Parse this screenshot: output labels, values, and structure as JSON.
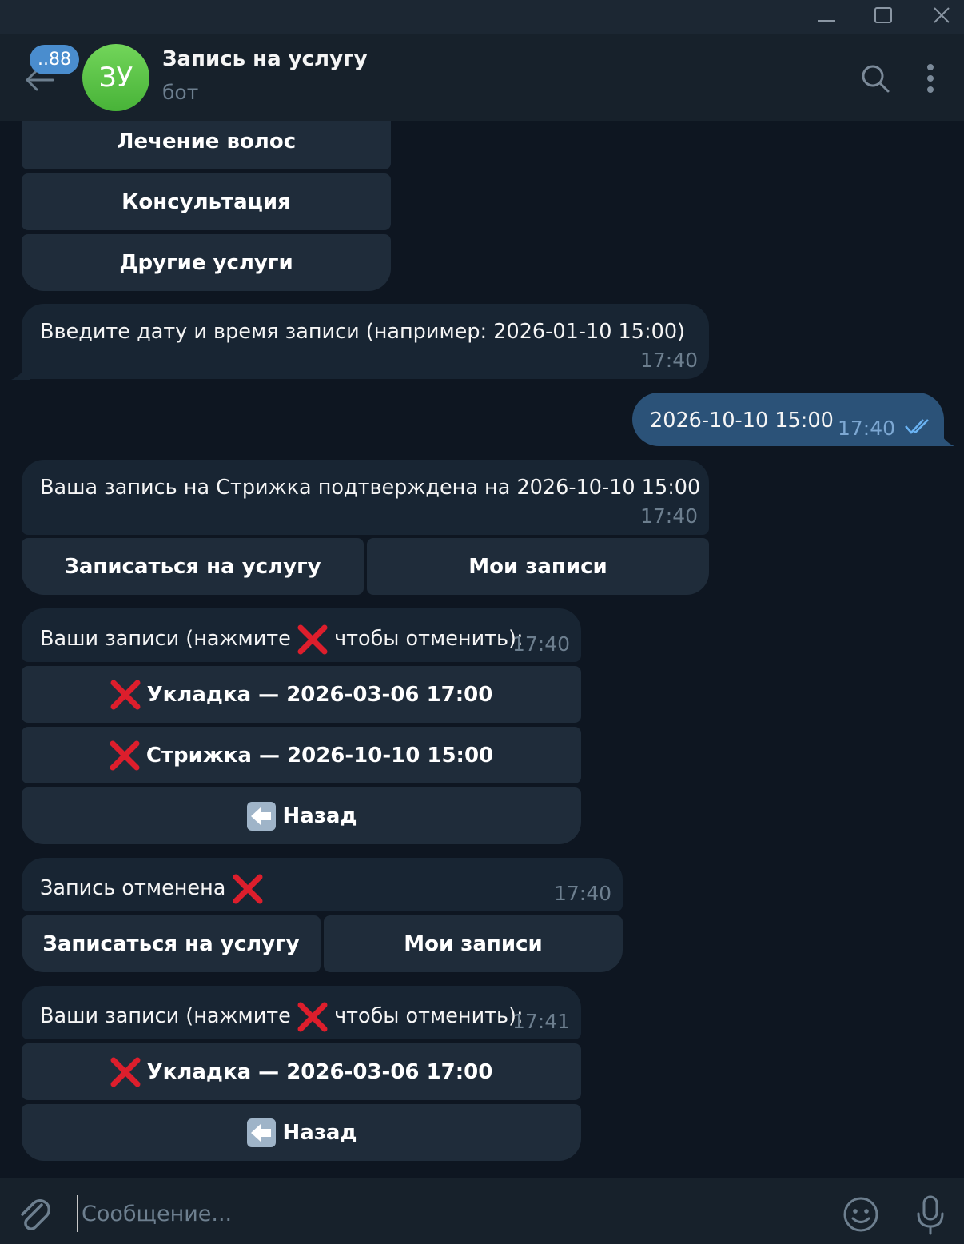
{
  "colors": {
    "bg": "#0e1621",
    "header": "#17212b",
    "bubble_in": "#182533",
    "bubble_out": "#2b5278",
    "button": "#1f2c3a",
    "accent": "#4a8dce",
    "cross": "#dd1e2c"
  },
  "window": {
    "minimize_icon": "minimize-icon",
    "maximize_icon": "maximize-icon",
    "close_icon": "close-icon"
  },
  "header": {
    "unread_badge": "..88",
    "avatar_initials": "ЗУ",
    "title": "Запись на услугу",
    "subtitle": "бот",
    "icons": [
      "back-arrow-icon",
      "search-icon",
      "more-vertical-icon"
    ]
  },
  "services_keyboard": [
    "Лечение волос",
    "Консультация",
    "Другие услуги"
  ],
  "messages": [
    {
      "text": "Введите дату и время записи (например: 2026-01-10 15:00)",
      "time": "17:40"
    },
    {
      "text": "2026-10-10 15:00",
      "time": "17:40",
      "status_icon": "double-check-icon"
    },
    {
      "text": "Ваша запись на Стрижка подтверждена на 2026-10-10 15:00",
      "time": "17:40"
    },
    {
      "text_before": "Ваши записи (нажмите",
      "text_after": "чтобы отменить):",
      "time": "17:40"
    },
    {
      "text": "Запись отменена",
      "time": "17:40"
    },
    {
      "text_before": "Ваши записи (нажмите",
      "text_after": "чтобы отменить):",
      "time": "17:41"
    }
  ],
  "main_menu_1": {
    "book": "Записаться на услугу",
    "my": "Мои записи"
  },
  "bookings_1": {
    "items": [
      "Укладка — 2026-03-06 17:00",
      "Стрижка — 2026-10-10 15:00"
    ],
    "back": "Назад"
  },
  "main_menu_2": {
    "book": "Записаться на услугу",
    "my": "Мои записи"
  },
  "bookings_2": {
    "items": [
      "Укладка — 2026-03-06 17:00"
    ],
    "back": "Назад"
  },
  "composer": {
    "placeholder": "Сообщение...",
    "icons": [
      "paperclip-icon",
      "emoji-icon",
      "microphone-icon"
    ]
  }
}
